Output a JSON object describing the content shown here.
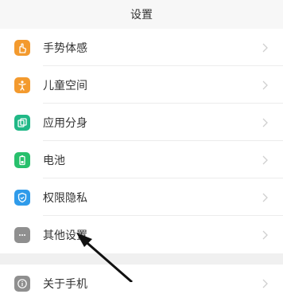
{
  "header": {
    "title": "设置"
  },
  "items": [
    {
      "label": "手势体感",
      "icon": "gesture-hand-icon",
      "color": "#f39a2e"
    },
    {
      "label": "儿童空间",
      "icon": "child-icon",
      "color": "#f39a2e"
    },
    {
      "label": "应用分身",
      "icon": "app-clone-icon",
      "color": "#20b886"
    },
    {
      "label": "电池",
      "icon": "battery-icon",
      "color": "#28c06c"
    },
    {
      "label": "权限隐私",
      "icon": "shield-icon",
      "color": "#2f9bea"
    },
    {
      "label": "其他设置",
      "icon": "more-dots-icon",
      "color": "#8f8f8f"
    }
  ],
  "items2": [
    {
      "label": "关于手机",
      "icon": "info-icon",
      "color": "#8f8f8f"
    }
  ],
  "annotation": {
    "arrow": "black-arrow"
  }
}
